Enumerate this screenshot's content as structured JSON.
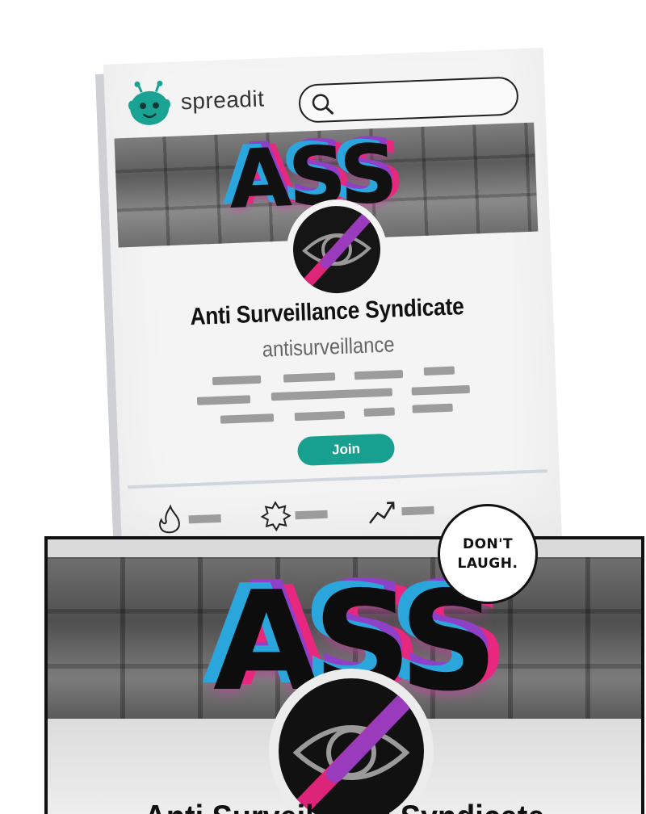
{
  "app": {
    "brand": "spreadit"
  },
  "search": {
    "placeholder": ""
  },
  "community": {
    "banner_text": "ASS",
    "name": "Anti Surveillance Syndicate",
    "handle": "antisurveillance",
    "join_label": "Join"
  },
  "sort_tabs": [
    {
      "icon": "flame-icon"
    },
    {
      "icon": "starburst-icon"
    },
    {
      "icon": "trending-icon"
    }
  ],
  "comic": {
    "speech_line1": "DON'T",
    "speech_line2": "LAUGH.",
    "panel_banner_text": "ASS",
    "panel_title": "Anti Surveillance Syndicate"
  },
  "colors": {
    "accent": "#17a08f",
    "logo": "#1aa393",
    "graffiti_blue": "#2aa6dd",
    "graffiti_purple": "#8e40c8",
    "graffiti_pink": "#e8287f"
  }
}
